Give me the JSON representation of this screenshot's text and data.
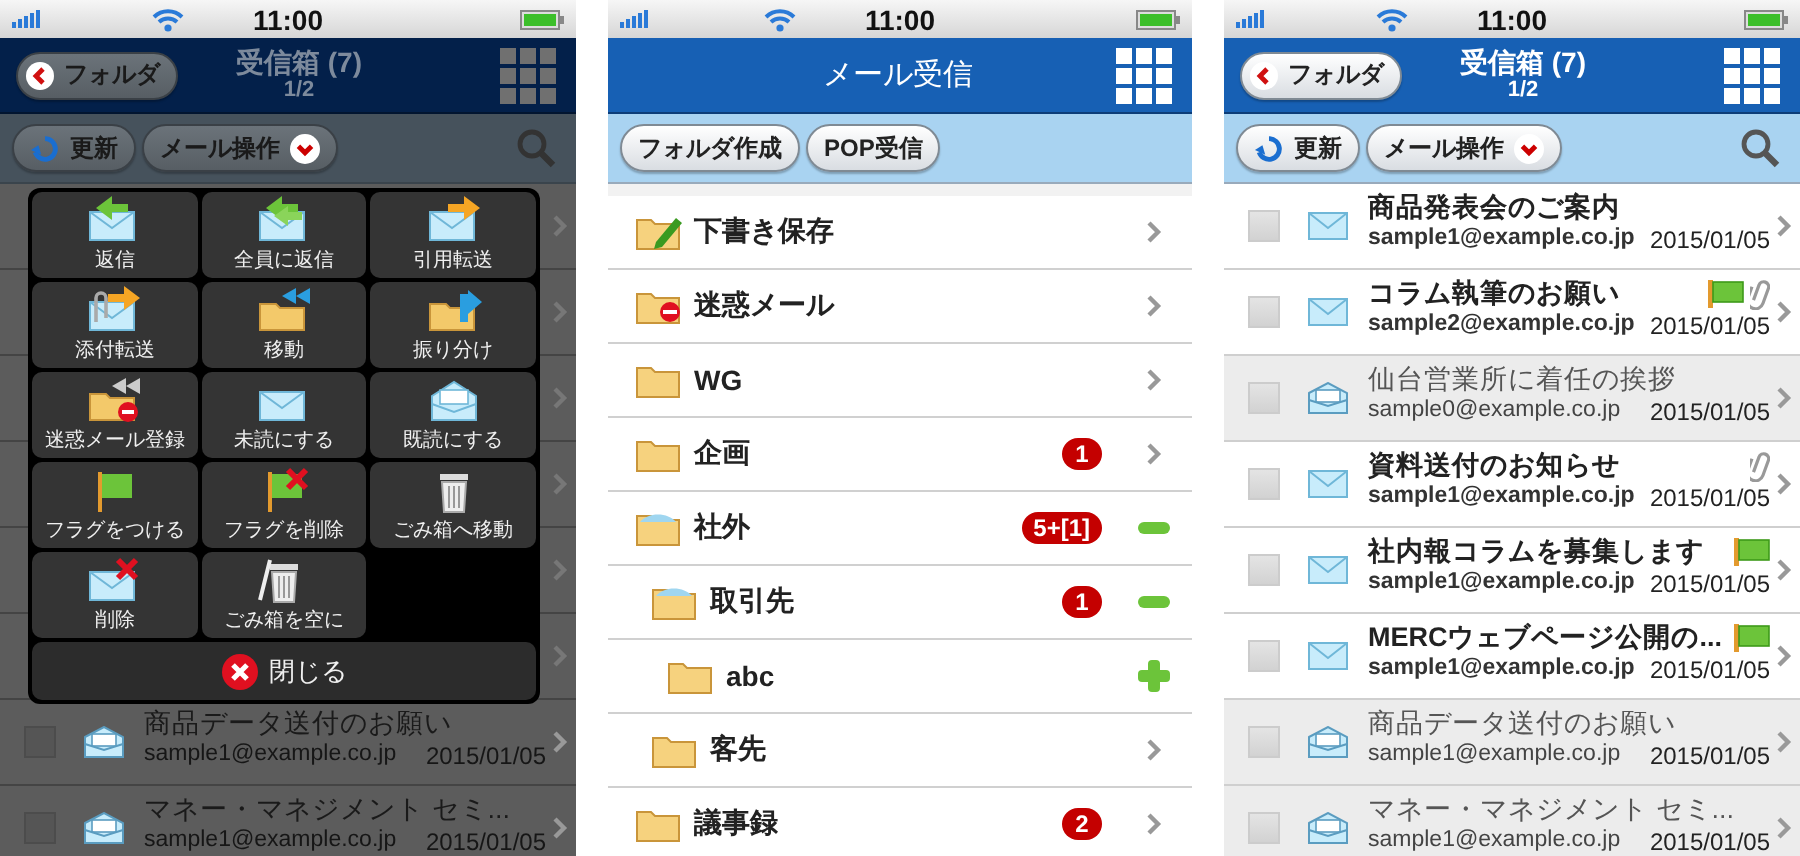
{
  "screens": [
    {
      "kind": "inbox",
      "dimmed": true,
      "status_bar": {
        "time": "11:00"
      },
      "header": {
        "back_button": "フォルダ",
        "title": "受信箱 (7)",
        "page": "1/2"
      },
      "toolbar": {
        "buttons": [
          "更新",
          "メール操作"
        ]
      },
      "mails": [
        {
          "subject": "商品データ送付のお願い",
          "sender": "sample1@example.co.jp",
          "date": "2015/01/05",
          "unread": false,
          "checked": false,
          "flagged": false,
          "attachment": false
        },
        {
          "subject": "マネー・マネジメント セミ...",
          "sender": "sample1@example.co.jp",
          "date": "2015/01/05",
          "unread": false,
          "checked": false,
          "flagged": false,
          "attachment": false
        }
      ],
      "menu": {
        "items": [
          "返信",
          "全員に返信",
          "引用転送",
          "添付転送",
          "移動",
          "振り分け",
          "迷惑メール登録",
          "未読にする",
          "既読にする",
          "フラグをつける",
          "フラグを削除",
          "ごみ箱へ移動",
          "削除",
          "ごみ箱を空に"
        ],
        "close_button": "閉じる"
      }
    },
    {
      "kind": "folders",
      "status_bar": {
        "time": "11:00"
      },
      "header": {
        "title": "メール受信"
      },
      "toolbar": {
        "buttons": [
          "フォルダ作成",
          "POP受信"
        ]
      },
      "folders": [
        {
          "name": "下書き保存",
          "kind": "draft"
        },
        {
          "name": "迷惑メール",
          "kind": "spam"
        },
        {
          "name": "WG",
          "kind": "folder"
        },
        {
          "name": "企画",
          "kind": "folder",
          "unread": "1"
        },
        {
          "name": "社外",
          "kind": "folder",
          "expanded": true,
          "unread": "5+[1]",
          "children": [
            {
              "name": "取引先",
              "kind": "folder",
              "expanded": true,
              "unread": "1",
              "children": [
                {
                  "name": "abc",
                  "kind": "folder",
                  "expanded": false
                }
              ]
            },
            {
              "name": "客先",
              "kind": "folder"
            }
          ]
        },
        {
          "name": "議事録",
          "kind": "folder",
          "unread": "2"
        }
      ]
    },
    {
      "kind": "inbox",
      "dimmed": false,
      "status_bar": {
        "time": "11:00"
      },
      "header": {
        "back_button": "フォルダ",
        "title": "受信箱 (7)",
        "page": "1/2"
      },
      "toolbar": {
        "buttons": [
          "更新",
          "メール操作"
        ]
      },
      "mails": [
        {
          "subject": "商品発表会のご案内",
          "sender": "sample1@example.co.jp",
          "date": "2015/01/05",
          "unread": true,
          "checked": false,
          "flagged": false,
          "attachment": false
        },
        {
          "subject": "コラム執筆のお願い",
          "sender": "sample2@example.co.jp",
          "date": "2015/01/05",
          "unread": true,
          "checked": false,
          "flagged": true,
          "attachment": true
        },
        {
          "subject": "仙台営業所に着任の挨拶",
          "sender": "sample0@example.co.jp",
          "date": "2015/01/05",
          "unread": false,
          "checked": false,
          "flagged": false,
          "attachment": false
        },
        {
          "subject": "資料送付のお知らせ",
          "sender": "sample1@example.co.jp",
          "date": "2015/01/05",
          "unread": true,
          "checked": false,
          "flagged": false,
          "attachment": true
        },
        {
          "subject": "社内報コラムを募集します",
          "sender": "sample1@example.co.jp",
          "date": "2015/01/05",
          "unread": true,
          "checked": false,
          "flagged": true,
          "attachment": false
        },
        {
          "subject": "MERCウェブページ公開の...",
          "sender": "sample1@example.co.jp",
          "date": "2015/01/05",
          "unread": true,
          "checked": false,
          "flagged": true,
          "attachment": false
        },
        {
          "subject": "商品データ送付のお願い",
          "sender": "sample1@example.co.jp",
          "date": "2015/01/05",
          "unread": false,
          "checked": false,
          "flagged": false,
          "attachment": false
        },
        {
          "subject": "マネー・マネジメント セミ...",
          "sender": "sample1@example.co.jp",
          "date": "2015/01/05",
          "unread": false,
          "checked": false,
          "flagged": false,
          "attachment": false
        }
      ]
    }
  ]
}
